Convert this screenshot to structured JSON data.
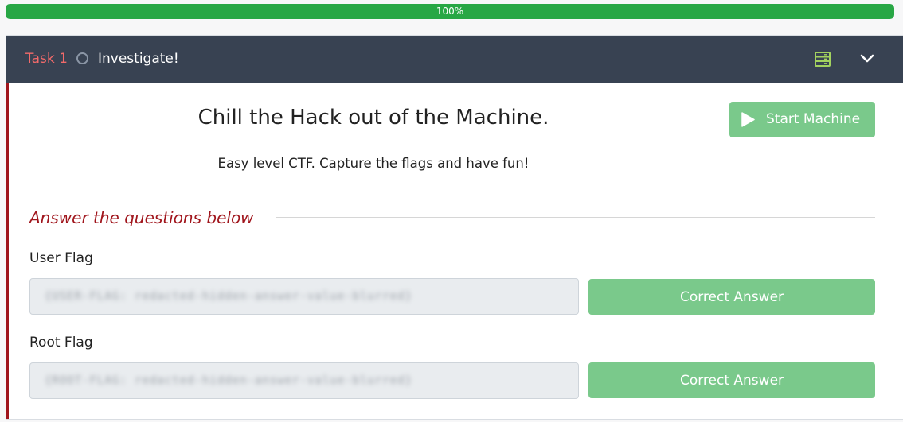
{
  "progress": {
    "label": "100%",
    "value": 1.0
  },
  "task": {
    "label": "Task 1",
    "title": "Investigate!",
    "heading": "Chill the Hack out of the Machine.",
    "description": "Easy level CTF.  Capture the flags and have fun!",
    "start_machine_label": "Start Machine"
  },
  "answers": {
    "section_title": "Answer the questions below",
    "questions": [
      {
        "label": "User Flag",
        "value": "{USER-FLAG: redacted-hidden-answer-value-blurred}",
        "button_label": "Correct Answer"
      },
      {
        "label": "Root Flag",
        "value": "{ROOT-FLAG: redacted-hidden-answer-value-blurred}",
        "button_label": "Correct Answer"
      }
    ]
  },
  "colors": {
    "header_bg": "#384252",
    "task_label": "#f26a6a",
    "accent_red": "#a0151c",
    "success_green": "#7ac98b",
    "progress_green": "#28a745",
    "server_icon": "#a3d25f"
  },
  "icons": [
    "status-circle-icon",
    "server-icon",
    "chevron-down-icon",
    "play-icon"
  ]
}
